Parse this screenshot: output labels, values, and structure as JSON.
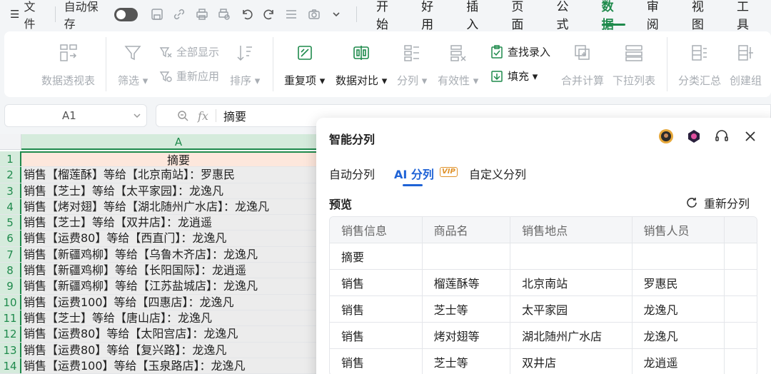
{
  "menubar": {
    "hamburger": "☰",
    "file": "文件",
    "autosave": "自动保存",
    "tabs": [
      "开始",
      "好用",
      "插入",
      "页面",
      "公式",
      "数据",
      "审阅",
      "视图",
      "工具"
    ],
    "active_tab": "数据"
  },
  "ribbon": {
    "pivot": "数据透视表",
    "filter": "筛选",
    "show_all": "全部显示",
    "reapply": "重新应用",
    "sort": "排序",
    "duplicates": "重复项",
    "compare": "数据对比",
    "split": "分列",
    "validity": "有效性",
    "lookup_entry": "查找录入",
    "fill": "填充",
    "consolidate": "合并计算",
    "dropdown_list": "下拉列表",
    "subtotal": "分类汇总",
    "create_group": "创建组"
  },
  "formula_bar": {
    "cell_ref": "A1",
    "fx": "fx",
    "content": "摘要"
  },
  "sheet": {
    "column": "A",
    "header_cell": "摘要",
    "rows": [
      {
        "num": "1",
        "text": "摘要"
      },
      {
        "num": "2",
        "text": "销售【榴莲酥】等给【北京南站】：罗惠民"
      },
      {
        "num": "3",
        "text": "销售【芝士】等给【太平家园】：龙逸凡"
      },
      {
        "num": "4",
        "text": "销售【烤对翅】等给【湖北随州广水店】：龙逸凡"
      },
      {
        "num": "5",
        "text": "销售【芝士】等给【双井店】：龙逍遥"
      },
      {
        "num": "6",
        "text": "销售【运费80】等给【西直门】：龙逸凡"
      },
      {
        "num": "7",
        "text": "销售【新疆鸡柳】等给【乌鲁木齐店】：龙逸凡"
      },
      {
        "num": "8",
        "text": "销售【新疆鸡柳】等给【长阳国际】：龙逍遥"
      },
      {
        "num": "9",
        "text": "销售【新疆鸡柳】等给【江苏盐城店】：龙逸凡"
      },
      {
        "num": "10",
        "text": "销售【运费100】等给【四惠店】：龙逸凡"
      },
      {
        "num": "11",
        "text": "销售【芝士】等给【唐山店】：龙逸凡"
      },
      {
        "num": "12",
        "text": "销售【运费80】等给【太阳宫店】：龙逸凡"
      },
      {
        "num": "13",
        "text": "销售【运费80】等给【复兴路】：龙逸凡"
      },
      {
        "num": "14",
        "text": "销售【运费100】等给【玉泉路店】：龙逸凡"
      }
    ]
  },
  "panel": {
    "title": "智能分列",
    "tabs": [
      "自动分列",
      "AI 分列",
      "自定义分列"
    ],
    "active_tab": "AI 分列",
    "vip_badge": "VIP",
    "preview_label": "预览",
    "resplit_label": "重新分列",
    "columns": [
      "销售信息",
      "商品名",
      "销售地点",
      "销售人员"
    ],
    "rows": [
      [
        "摘要",
        "",
        "",
        ""
      ],
      [
        "销售",
        "榴莲酥等",
        "北京南站",
        "罗惠民"
      ],
      [
        "销售",
        "芝士等",
        "太平家园",
        "龙逸凡"
      ],
      [
        "销售",
        "烤对翅等",
        "湖北随州广水店",
        "龙逸凡"
      ],
      [
        "销售",
        "芝士等",
        "双井店",
        "龙逍遥"
      ]
    ]
  },
  "colors": {
    "accent_green": "#1f8a4c",
    "ai_blue": "#1f63d6",
    "vip_orange": "#e0922a",
    "header_cell_bg": "#fde7dc"
  }
}
